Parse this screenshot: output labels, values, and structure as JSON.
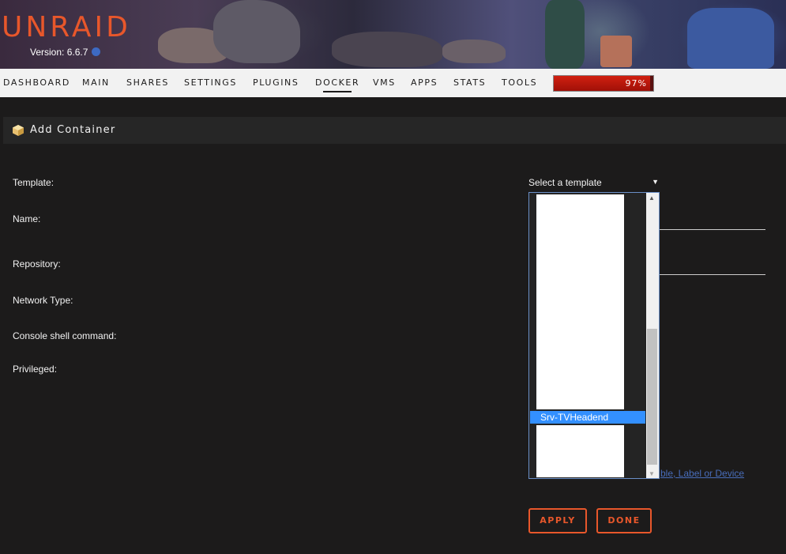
{
  "header": {
    "logo": "UNRAID",
    "version": "Version: 6.6.7"
  },
  "nav": {
    "items": [
      {
        "label": "DASHBOARD"
      },
      {
        "label": "MAIN"
      },
      {
        "label": "SHARES"
      },
      {
        "label": "SETTINGS"
      },
      {
        "label": "PLUGINS"
      },
      {
        "label": "DOCKER"
      },
      {
        "label": "VMS"
      },
      {
        "label": "APPS"
      },
      {
        "label": "STATS"
      },
      {
        "label": "TOOLS"
      }
    ],
    "active": "DOCKER",
    "usage": {
      "value": 97,
      "label": "97%"
    }
  },
  "section": {
    "title": "Add Container",
    "icon": "container-box-icon"
  },
  "form": {
    "labels": {
      "template": "Template:",
      "name": "Name:",
      "repository": "Repository:",
      "network_type": "Network Type:",
      "console": "Console shell command:",
      "privileged": "Privileged:"
    },
    "template_select": {
      "value": "Select a template",
      "highlighted_option": "Srv-TVHeadend"
    },
    "add_link": "ble, Label or Device"
  },
  "buttons": {
    "apply": "APPLY",
    "done": "DONE"
  },
  "colors": {
    "accent": "#e8572b",
    "selection": "#3390ff",
    "background": "#1c1b1b"
  }
}
